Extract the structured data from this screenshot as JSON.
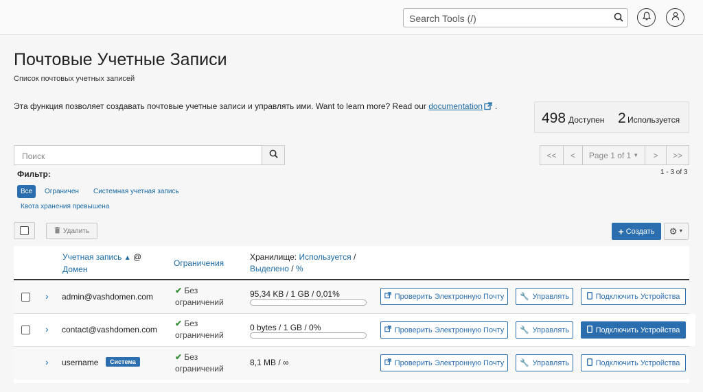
{
  "topbar": {
    "search_placeholder": "Search Tools (/)",
    "notifications_icon": "bell-icon",
    "user_icon": "user-icon"
  },
  "header": {
    "title": "Почтовые Учетные Записи",
    "subtitle": "Список почтовых учетных записей",
    "intro_text": "Эта функция позволяет создавать почтовые учетные записи и управлять ими. Want to learn more? Read our",
    "intro_link": "documentation",
    "intro_end": "."
  },
  "stats": {
    "available_count": "498",
    "available_label": "Доступен",
    "used_count": "2",
    "used_label": "Используется"
  },
  "search": {
    "placeholder": "Поиск"
  },
  "pagination": {
    "first": "<<",
    "prev": "<",
    "page_label": "Page 1 of 1",
    "next": ">",
    "last": ">>",
    "count": "1 - 3 of 3"
  },
  "filter": {
    "label": "Фильтр:",
    "options": [
      "Все",
      "Ограничен",
      "Системная учетная запись",
      "Квота хранения превышена"
    ],
    "active": "Все"
  },
  "toolbar": {
    "delete_label": "Удалить",
    "create_label": "Создать"
  },
  "table": {
    "headers": {
      "account": "Учетная запись",
      "at": "@",
      "domain": "Домен",
      "limits": "Ограничения",
      "storage_prefix": "Хранилище:",
      "storage_used": "Используется",
      "slash1": "/",
      "storage_allocated": "Выделено",
      "slash2": "/",
      "storage_percent": "%"
    },
    "rows": [
      {
        "account": "admin@vashdomen.com",
        "limit_line1": "Без",
        "limit_line2": "ограничений",
        "storage": "95,34 KB / 1 GB / 0,01%",
        "usage_fraction": 0.0001,
        "check_mail": "Проверить Электронную Почту",
        "manage": "Управлять",
        "connect": "Подключить Устройства"
      },
      {
        "account": "contact@vashdomen.com",
        "limit_line1": "Без",
        "limit_line2": "ограничений",
        "storage": "0 bytes / 1 GB / 0%",
        "usage_fraction": 0,
        "check_mail": "Проверить Электронную Почту",
        "manage": "Управлять",
        "connect": "Подключить Устройства"
      },
      {
        "account": "username",
        "badge": "Система",
        "limit_line1": "Без",
        "limit_line2": "ограничений",
        "storage": "8,1 MB / ∞",
        "check_mail": "Проверить Электронную Почту",
        "manage": "Управлять",
        "connect": "Подключить Устройства"
      }
    ]
  },
  "colors": {
    "accent": "#2a6eb0",
    "link": "#1a6aa6",
    "check": "#3a8f3a"
  }
}
